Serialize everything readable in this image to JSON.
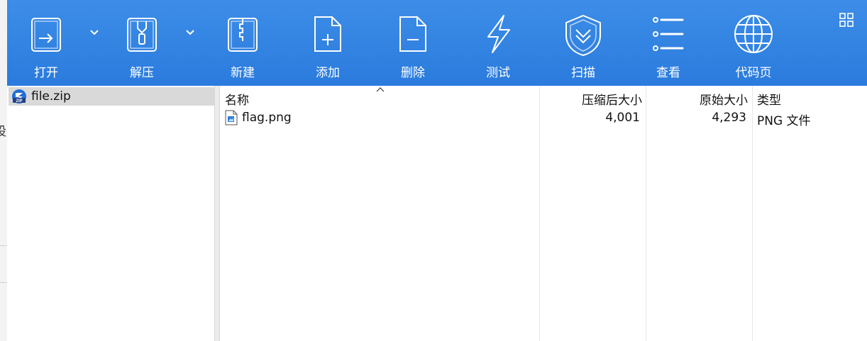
{
  "background_window": {
    "partial_char": "设"
  },
  "toolbar": {
    "buttons": [
      {
        "label": "打开",
        "icon": "open-icon"
      },
      {
        "label": "解压",
        "icon": "extract-icon"
      },
      {
        "label": "新建",
        "icon": "new-archive-icon"
      },
      {
        "label": "添加",
        "icon": "add-file-icon"
      },
      {
        "label": "删除",
        "icon": "delete-file-icon"
      },
      {
        "label": "测试",
        "icon": "test-lightning-icon"
      },
      {
        "label": "扫描",
        "icon": "scan-shield-icon"
      },
      {
        "label": "查看",
        "icon": "view-list-icon"
      },
      {
        "label": "代码页",
        "icon": "codepage-globe-icon"
      }
    ],
    "view_switch_icon": "tile-view-icon",
    "colors": {
      "toolbar_bg": "#2a7bdd",
      "toolbar_text": "#ffffff"
    }
  },
  "tree": {
    "items": [
      {
        "label": "file.zip",
        "icon": "zip-archive-icon",
        "selected": true
      }
    ]
  },
  "file_list": {
    "columns": [
      "名称",
      "压缩后大小",
      "原始大小",
      "类型"
    ],
    "sort_column": "名称",
    "rows": [
      {
        "name": "flag.png",
        "compressed": "4,001",
        "original": "4,293",
        "type": "PNG 文件",
        "icon": "png-file-icon"
      }
    ]
  }
}
